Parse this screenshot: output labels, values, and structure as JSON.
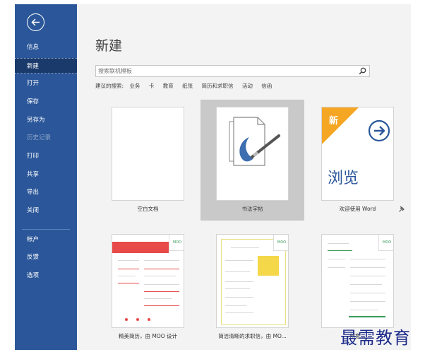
{
  "sidebar": {
    "items": [
      {
        "label": "信息",
        "state": "normal"
      },
      {
        "label": "新建",
        "state": "active"
      },
      {
        "label": "打开",
        "state": "normal"
      },
      {
        "label": "保存",
        "state": "normal"
      },
      {
        "label": "另存为",
        "state": "normal"
      },
      {
        "label": "历史记录",
        "state": "disabled"
      },
      {
        "label": "打印",
        "state": "normal"
      },
      {
        "label": "共享",
        "state": "normal"
      },
      {
        "label": "导出",
        "state": "normal"
      },
      {
        "label": "关闭",
        "state": "normal"
      },
      {
        "label": "帐户",
        "state": "normal"
      },
      {
        "label": "反馈",
        "state": "normal"
      },
      {
        "label": "选项",
        "state": "normal"
      }
    ]
  },
  "main": {
    "title": "新建",
    "search": {
      "placeholder": "搜索联机模板"
    },
    "suggested": {
      "label": "建议的搜索:",
      "items": [
        "业务",
        "卡",
        "教育",
        "纸张",
        "简历和求职信",
        "活动",
        "信函"
      ]
    },
    "templates": [
      {
        "label": "空白文档"
      },
      {
        "label": "书法字帖"
      },
      {
        "label": "欢迎使用 Word",
        "badge": "新",
        "browse_text": "浏览"
      },
      {
        "label": "精美简历，由 MOO 设计"
      },
      {
        "label": "简洁清晰的求职信，由 MO..."
      },
      {
        "label": "创意..."
      }
    ],
    "moo_badge": "MOO"
  },
  "watermark": "最需教育",
  "colors": {
    "sidebar": "#2b579a",
    "sidebar_active": "#1a3a6b",
    "badge_orange": "#f5a623",
    "accent_blue": "#2b579a"
  }
}
